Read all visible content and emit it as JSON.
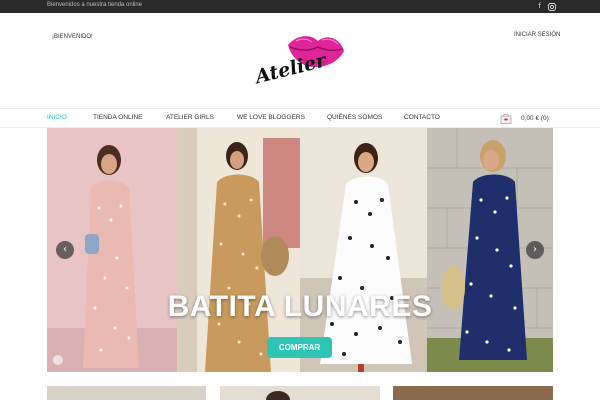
{
  "topbar": {
    "welcome_text": "Bienvenidos a nuestra tienda online",
    "social_icons": [
      "facebook-icon",
      "instagram-icon"
    ]
  },
  "header": {
    "greeting": "¡BIENVENIDO!",
    "login_label": "INICIAR SESIÓN",
    "logo_text": "Atelier"
  },
  "nav": {
    "items": [
      {
        "label": "INICIO",
        "active": true
      },
      {
        "label": "TIENDA ONLINE",
        "active": false
      },
      {
        "label": "ATELIER GIRLS",
        "active": false
      },
      {
        "label": "WE LOVE BLOGGERS",
        "active": false
      },
      {
        "label": "QUIÉNES SOMOS",
        "active": false
      },
      {
        "label": "CONTACTO",
        "active": false
      }
    ],
    "cart_total": "0,00 € (0)"
  },
  "slider": {
    "title": "BATITA LUNARES",
    "button_label": "COMPRAR"
  },
  "colors": {
    "accent": "#2ec4b6",
    "topbar": "#2a2a2a",
    "logo_lips": "#e0249a"
  }
}
